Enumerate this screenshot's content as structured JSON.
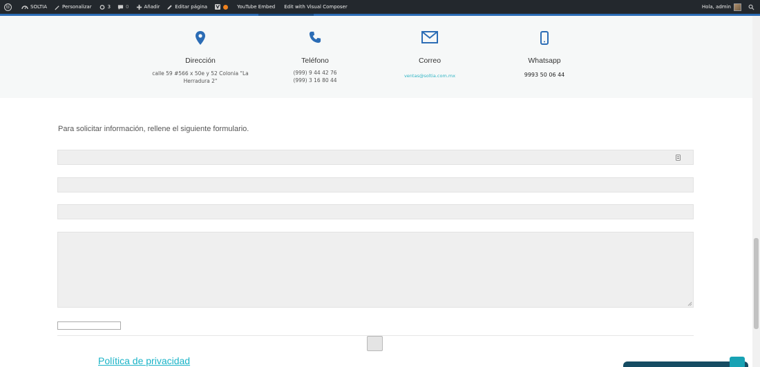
{
  "adminbar": {
    "site_name": "SOLTIA",
    "customize": "Personalizar",
    "updates_count": "3",
    "comments_count": "0",
    "add_new": "Añadir",
    "edit_page": "Editar página",
    "youtube_embed": "YouTube Embed",
    "visual_composer": "Edit with Visual Composer",
    "greeting": "Hola, admin"
  },
  "contact": {
    "address": {
      "title": "Dirección",
      "lines": [
        "calle 59 #566 x 50e y 52 Colonia \"La",
        "Herradura 2\""
      ]
    },
    "phone": {
      "title": "Teléfono",
      "lines": [
        "(999) 9 44 42 76",
        "(999) 3 16 80 44"
      ]
    },
    "email": {
      "title": "Correo",
      "value": "ventas@soltia.com.mx"
    },
    "whatsapp": {
      "title": "Whatsapp",
      "value": "9993 50 06 44"
    }
  },
  "form": {
    "intro": "Para solicitar información, rellene el siguiente formulario."
  },
  "footer": {
    "privacy_link": "Política de privacidad"
  },
  "colors": {
    "accent": "#2b6cb5",
    "link": "#19b3c7",
    "adminbar_bg": "#23282d"
  }
}
